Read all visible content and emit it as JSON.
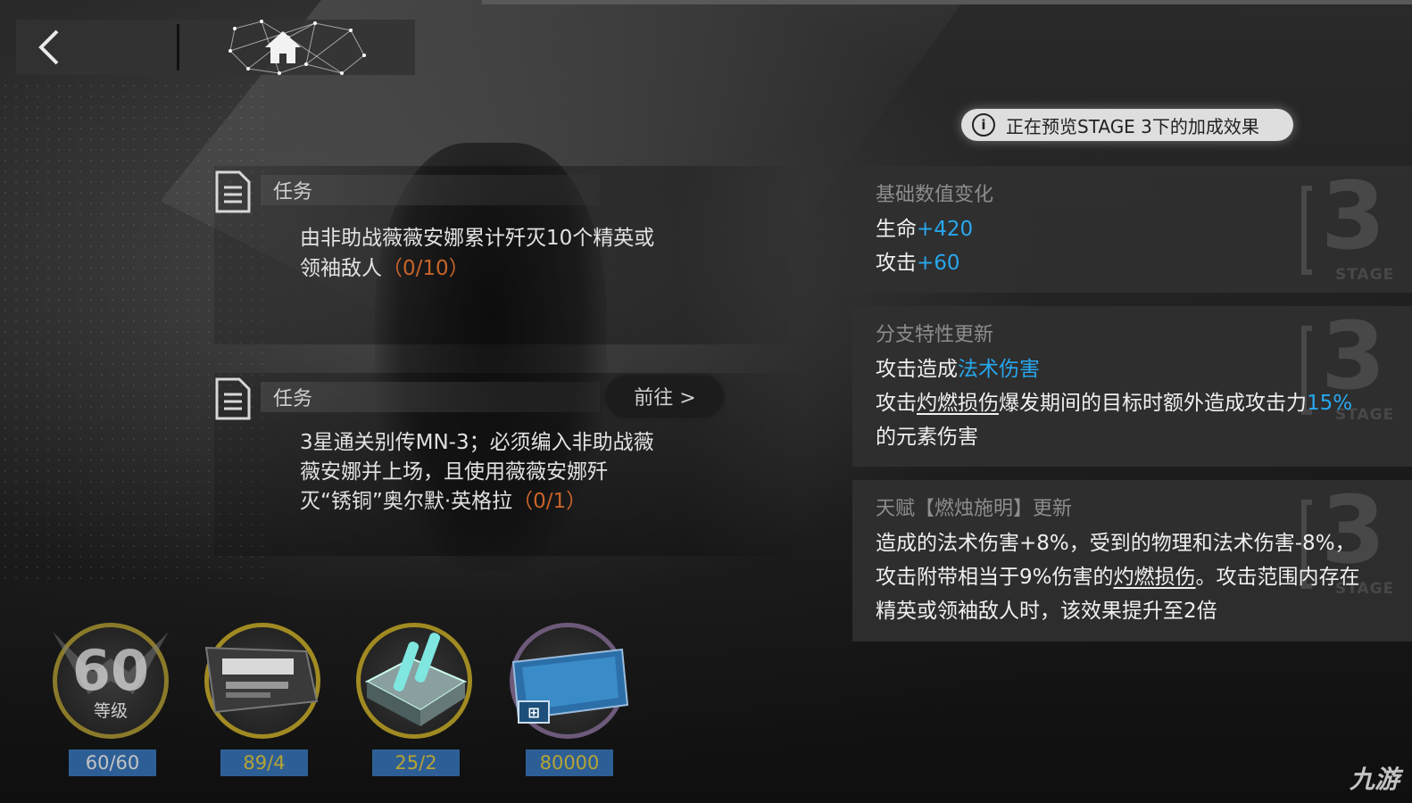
{
  "nav": {
    "back_icon": "chevron-left-icon",
    "home_icon": "home-icon"
  },
  "tasks": [
    {
      "label": "任务",
      "text": "由非助战薇薇安娜累计歼灭10个精英或领袖敌人",
      "progress": "（0/10）"
    },
    {
      "label": "任务",
      "text": "3星通关别传MN-3；必须编入非助战薇薇安娜并上场，且使用薇薇安娜歼灭“锈铜”奥尔默·英格拉",
      "progress": "（0/1）",
      "goto_label": "前往 >"
    }
  ],
  "preview": {
    "text": "正在预览STAGE 3下的加成效果"
  },
  "panels": [
    {
      "title": "基础数值变化",
      "stage_num": "3",
      "stage_word": "STAGE",
      "line1_label": "生命",
      "line1_value": "+420",
      "line2_label": "攻击",
      "line2_value": "+60"
    },
    {
      "title": "分支特性更新",
      "stage_num": "3",
      "stage_word": "STAGE",
      "line1_a": "攻击造成",
      "line1_b": "法术伤害",
      "line2_a": "攻击",
      "line2_b": "灼燃损伤",
      "line2_c": "爆发期间的目标时额外造成攻击力",
      "line2_d": "15%",
      "line3": "的元素伤害"
    },
    {
      "title": "天赋【燃烛施明】更新",
      "stage_num": "3",
      "stage_word": "STAGE",
      "line1": "造成的法术伤害+8%，受到的物理和法术伤害-8%，",
      "line2_a": "攻击附带相当于9%伤害的",
      "line2_b": "灼燃损伤",
      "line2_c": "。攻击范围内存在",
      "line3": "精英或领袖敌人时，该效果提升至2倍"
    }
  ],
  "requirements": [
    {
      "type": "level",
      "num": "60",
      "label": "等级",
      "value": "60/60"
    },
    {
      "type": "item",
      "icon": "raythean-module-icon",
      "value": "89/4"
    },
    {
      "type": "item",
      "icon": "vial-crate-icon",
      "value": "25/2"
    },
    {
      "type": "item",
      "icon": "lmd-ticket-icon",
      "value": "80000"
    }
  ],
  "watermark": "九游",
  "colors": {
    "accent_blue": "#27a7ee",
    "progress_orange": "#c8642a",
    "value_bar": "#2d5f96",
    "ring_gold": "#a08a22"
  }
}
